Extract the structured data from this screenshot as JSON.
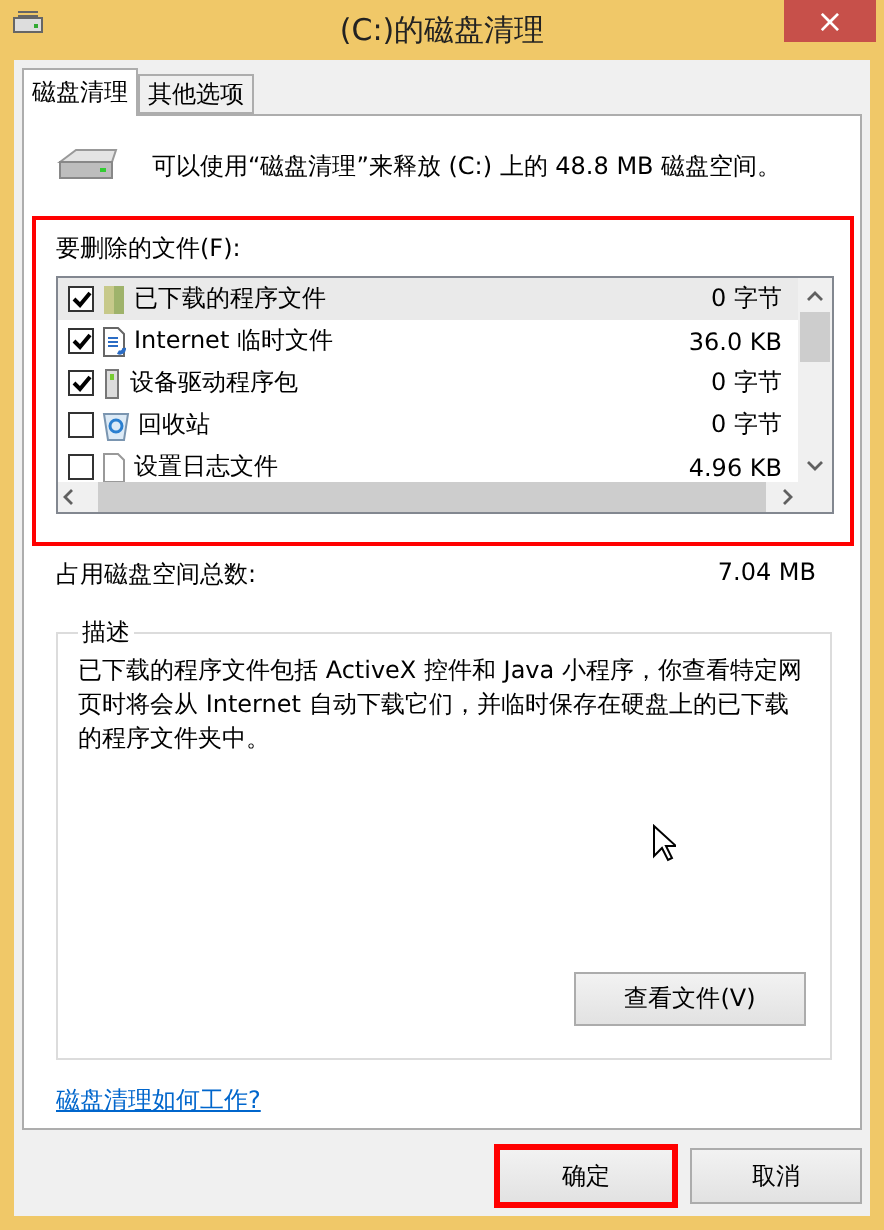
{
  "window": {
    "title": "(C:)的磁盘清理",
    "close": "×"
  },
  "tabs": [
    {
      "label": "磁盘清理",
      "selected": true
    },
    {
      "label": "其他选项",
      "selected": false
    }
  ],
  "summary": "可以使用“磁盘清理”来释放  (C:) 上的 48.8 MB 磁盘空间。",
  "files": {
    "label": "要删除的文件(F):",
    "highlighted": true,
    "items": [
      {
        "name": "已下载的程序文件",
        "size": "0 字节",
        "checked": true,
        "selected": true,
        "kind": "folder"
      },
      {
        "name": "Internet 临时文件",
        "size": "36.0 KB",
        "checked": true,
        "selected": false,
        "kind": "document"
      },
      {
        "name": "设备驱动程序包",
        "size": "0 字节",
        "checked": true,
        "selected": false,
        "kind": "driver"
      },
      {
        "name": "回收站",
        "size": "0 字节",
        "checked": false,
        "selected": false,
        "kind": "bin"
      },
      {
        "name": "设置日志文件",
        "size": "4.96 KB",
        "checked": false,
        "selected": false,
        "kind": "page"
      }
    ]
  },
  "total": {
    "label": "占用磁盘空间总数:",
    "value": "7.04 MB"
  },
  "description": {
    "legend": "描述",
    "text": "已下载的程序文件包括 ActiveX 控件和 Java 小程序，你查看特定网页时将会从 Internet 自动下载它们，并临时保存在硬盘上的已下载的程序文件夹中。",
    "button": "查看文件(V)"
  },
  "help_link": "磁盘清理如何工作?",
  "buttons": [
    {
      "label": "确定",
      "highlighted": true
    },
    {
      "label": "取消",
      "highlighted": false
    }
  ]
}
